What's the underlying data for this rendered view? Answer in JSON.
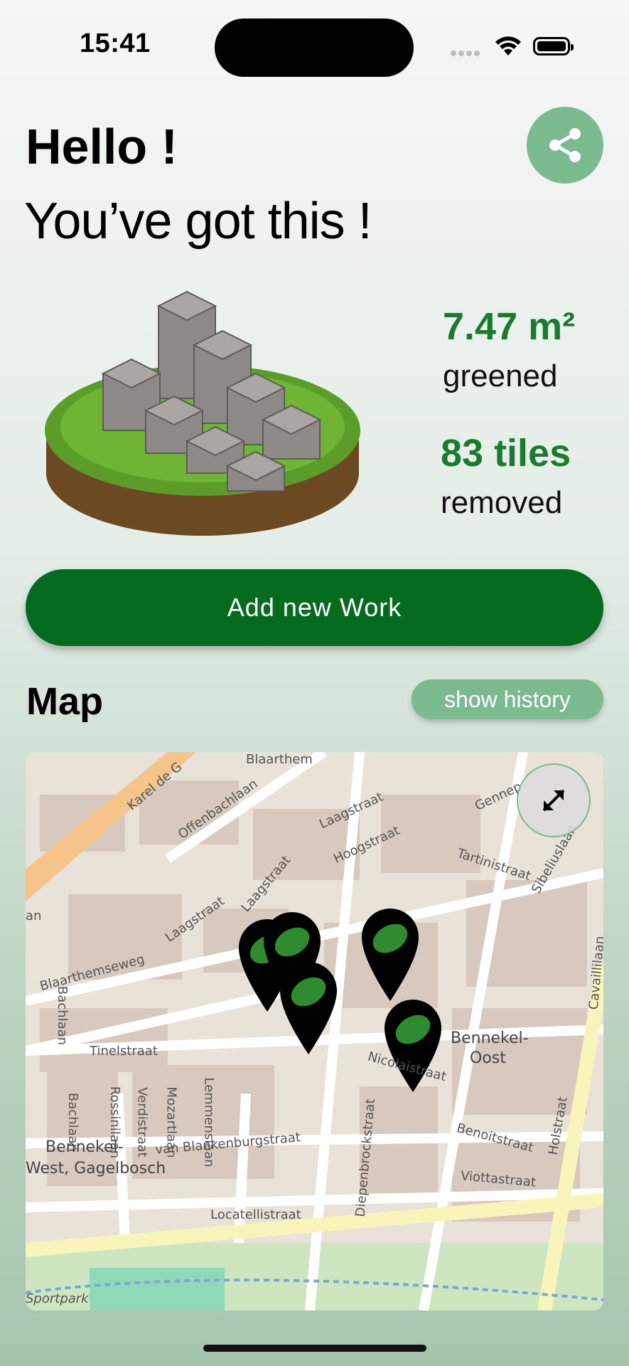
{
  "status_bar": {
    "time": "15:41"
  },
  "header": {
    "greeting": "Hello !",
    "subtitle": "You’ve got this !"
  },
  "stats": {
    "greened_value": "7.47 m²",
    "greened_label": "greened",
    "tiles_value": "83 tiles",
    "tiles_label": "removed"
  },
  "actions": {
    "add_work": "Add new Work"
  },
  "map_section": {
    "title": "Map",
    "history_button": "show history",
    "labels": [
      "Blaarthem",
      "Karel de G",
      "Offenbachlaan",
      "Laagstraat",
      "Hoogstraat",
      "Gennep",
      "Tartinistraat",
      "Sibeliuslaan",
      "Laagstraat",
      "Laagstraat",
      "Blaarthemseweg",
      "Bachlaan",
      "Tinelstraat",
      "Bennekel-",
      "Oost",
      "Nicolaistraat",
      "Bachlaan",
      "Rossinilaan",
      "Verdistraat",
      "Mozartlaan",
      "Lemmenslaan",
      "Bennekel-",
      "West, Gagelbosch",
      "van Blankenburgstraat",
      "Diepenbrockstraat",
      "Benoitstraat",
      "Holstraat",
      "Viottastraat",
      "Locatellistraat",
      "Sportpark",
      "Cavaillilaan",
      "an"
    ],
    "markers": 5
  },
  "colors": {
    "accent": "#046b1f",
    "accent_light": "#7cbb8f",
    "stat": "#1a7a2f"
  }
}
